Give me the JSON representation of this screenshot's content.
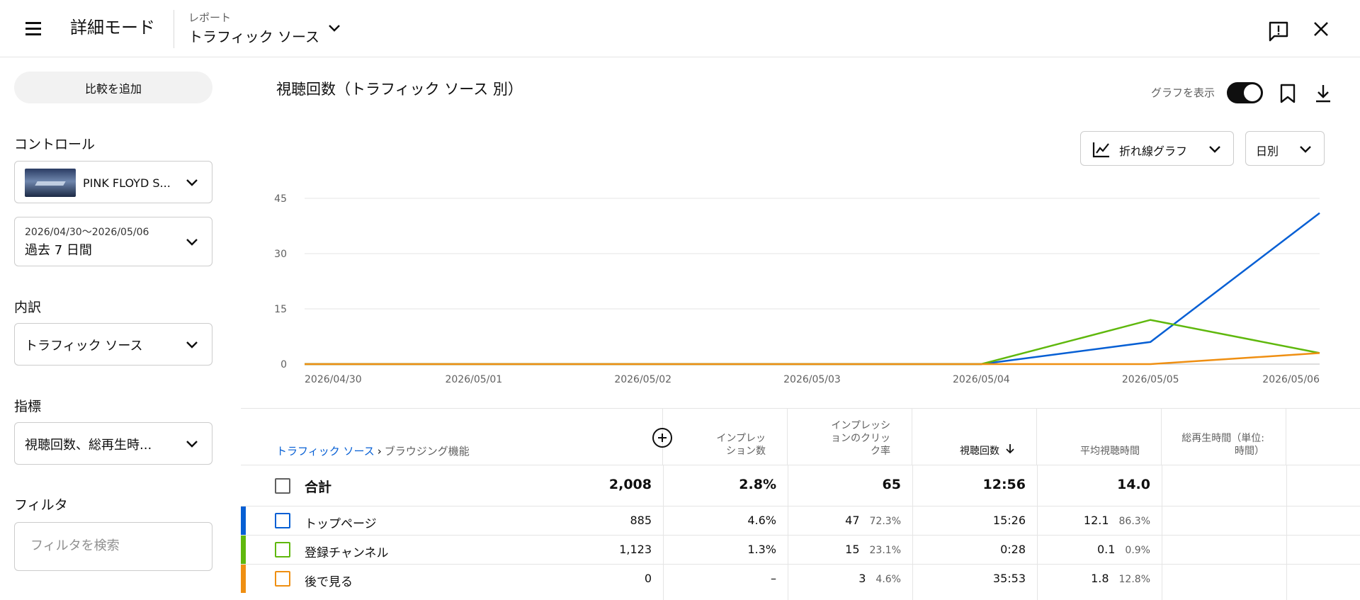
{
  "header": {
    "mode_title": "詳細モード",
    "report_label": "レポート",
    "report_name": "トラフィック ソース"
  },
  "sidebar": {
    "compare_button": "比較を追加",
    "control_title": "コントロール",
    "video_name": "PINK FLOYD S...",
    "date_range": "2026/04/30～2026/05/06",
    "date_preset": "過去 7 日間",
    "breakdown_title": "内訳",
    "breakdown_value": "トラフィック ソース",
    "metrics_title": "指標",
    "metrics_value": "視聴回数、総再生時...",
    "filter_title": "フィルタ",
    "filter_placeholder": "フィルタを検索"
  },
  "main": {
    "chart_title": "視聴回数（トラフィック ソース 別）",
    "show_graph_label": "グラフを表示",
    "show_graph_on": true,
    "chart_type": "折れ線グラフ",
    "period": "日別"
  },
  "chart_data": {
    "type": "line",
    "x": [
      "2026/04/30",
      "2026/05/01",
      "2026/05/02",
      "2026/05/03",
      "2026/05/04",
      "2026/05/05",
      "2026/05/06"
    ],
    "ylim": [
      0,
      45
    ],
    "yticks": [
      0,
      15,
      30,
      45
    ],
    "grid": true,
    "series": [
      {
        "name": "トップページ",
        "color": "#065fd4",
        "values": [
          0,
          0,
          0,
          0,
          0,
          6,
          41
        ]
      },
      {
        "name": "登録チャンネル",
        "color": "#5fb80d",
        "values": [
          0,
          0,
          0,
          0,
          0,
          12,
          3
        ]
      },
      {
        "name": "後で見る",
        "color": "#ef8f12",
        "values": [
          0,
          0,
          0,
          0,
          0,
          0,
          3
        ]
      }
    ]
  },
  "table": {
    "breadcrumb_root": "トラフィック ソース",
    "breadcrumb_current": "ブラウジング機能",
    "headers": {
      "impressions": "インプレッション数",
      "ctr": "インプレッションのクリック率",
      "views": "視聴回数",
      "avg_duration": "平均視聴時間",
      "watch_time": "総再生時間（単位: 時間）"
    },
    "total": {
      "label": "合計",
      "impressions": "2,008",
      "ctr": "2.8%",
      "views": "65",
      "avg_duration": "12:56",
      "watch_time": "14.0"
    },
    "rows": [
      {
        "label": "トップページ",
        "color": "#065fd4",
        "impressions": "885",
        "ctr": "4.6%",
        "views": "47",
        "views_pct": "72.3%",
        "avg_duration": "15:26",
        "watch_time": "12.1",
        "watch_pct": "86.3%"
      },
      {
        "label": "登録チャンネル",
        "color": "#5fb80d",
        "impressions": "1,123",
        "ctr": "1.3%",
        "views": "15",
        "views_pct": "23.1%",
        "avg_duration": "0:28",
        "watch_time": "0.1",
        "watch_pct": "0.9%"
      },
      {
        "label": "後で見る",
        "color": "#ef8f12",
        "impressions": "0",
        "ctr": "–",
        "views": "3",
        "views_pct": "4.6%",
        "avg_duration": "35:53",
        "watch_time": "1.8",
        "watch_pct": "12.8%"
      }
    ]
  }
}
